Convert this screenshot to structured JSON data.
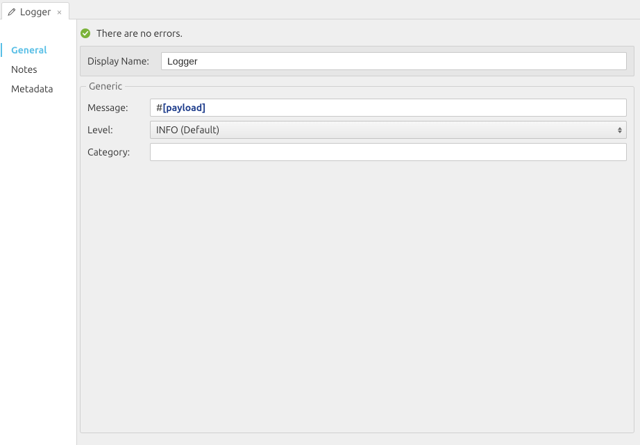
{
  "tab": {
    "title": "Logger"
  },
  "nav": {
    "items": [
      {
        "label": "General",
        "selected": true
      },
      {
        "label": "Notes",
        "selected": false
      },
      {
        "label": "Metadata",
        "selected": false
      }
    ]
  },
  "status": {
    "text": "There are no errors."
  },
  "display_name": {
    "label": "Display Name:",
    "value": "Logger"
  },
  "generic": {
    "legend": "Generic",
    "message": {
      "label": "Message:",
      "prefix": "#",
      "open": "[",
      "token": "payload",
      "close": "]"
    },
    "level": {
      "label": "Level:",
      "selected": "INFO (Default)"
    },
    "category": {
      "label": "Category:",
      "value": ""
    }
  }
}
